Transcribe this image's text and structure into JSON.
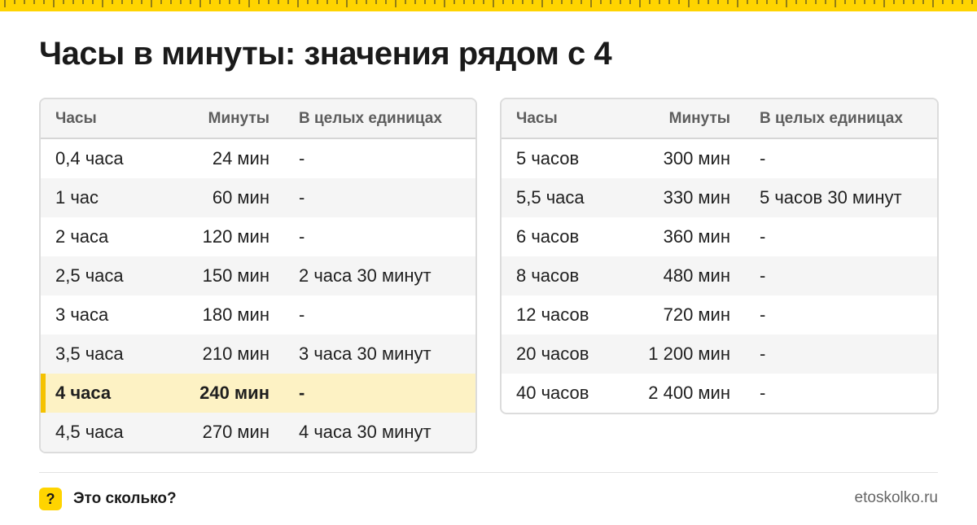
{
  "colors": {
    "accent": "#ffd400",
    "highlight_row": "#fdf2c4",
    "highlight_bar": "#f5c200",
    "alt_row": "#f5f5f5"
  },
  "title": "Часы в минуты: значения рядом с 4",
  "columns": [
    "Часы",
    "Минуты",
    "В целых единицах"
  ],
  "table_left": {
    "rows": [
      {
        "hours": "0,4 часа",
        "minutes": "24 мин",
        "whole": "-"
      },
      {
        "hours": "1 час",
        "minutes": "60 мин",
        "whole": "-"
      },
      {
        "hours": "2 часа",
        "minutes": "120 мин",
        "whole": "-"
      },
      {
        "hours": "2,5 часа",
        "minutes": "150 мин",
        "whole": "2 часа 30 минут"
      },
      {
        "hours": "3 часа",
        "minutes": "180 мин",
        "whole": "-"
      },
      {
        "hours": "3,5 часа",
        "minutes": "210 мин",
        "whole": "3 часа 30 минут"
      },
      {
        "hours": "4 часа",
        "minutes": "240 мин",
        "whole": "-",
        "highlighted": true
      },
      {
        "hours": "4,5 часа",
        "minutes": "270 мин",
        "whole": "4 часа 30 минут"
      }
    ]
  },
  "table_right": {
    "rows": [
      {
        "hours": "5 часов",
        "minutes": "300 мин",
        "whole": "-"
      },
      {
        "hours": "5,5 часа",
        "minutes": "330 мин",
        "whole": "5 часов 30 минут"
      },
      {
        "hours": "6 часов",
        "minutes": "360 мин",
        "whole": "-"
      },
      {
        "hours": "8 часов",
        "minutes": "480 мин",
        "whole": "-"
      },
      {
        "hours": "12 часов",
        "minutes": "720 мин",
        "whole": "-"
      },
      {
        "hours": "20 часов",
        "minutes": "1 200 мин",
        "whole": "-"
      },
      {
        "hours": "40 часов",
        "minutes": "2 400 мин",
        "whole": "-"
      }
    ]
  },
  "footer": {
    "icon": "question-icon",
    "icon_glyph": "?",
    "brand_name": "Это сколько?",
    "site": "etoskolko.ru"
  }
}
